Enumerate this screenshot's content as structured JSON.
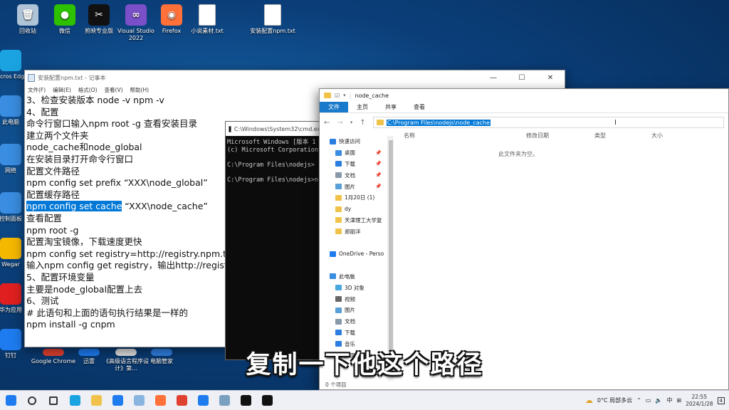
{
  "desktop": {
    "icons": [
      {
        "label": "回收站",
        "color": "#b0c4d8",
        "glyph": "🗑",
        "name": "recycle-bin-icon"
      },
      {
        "label": "微信",
        "color": "#2dc100",
        "glyph": "●",
        "name": "wechat-icon"
      },
      {
        "label": "剪映专业版",
        "color": "#111111",
        "glyph": "✂",
        "name": "jianying-icon"
      },
      {
        "label": "Visual Studio 2022",
        "color": "#7a4fc7",
        "glyph": "∞",
        "name": "visual-studio-icon"
      },
      {
        "label": "Firefox",
        "color": "#ff7139",
        "glyph": "◉",
        "name": "firefox-icon"
      },
      {
        "label": "小说素材.txt",
        "color": "#ffffff",
        "glyph": "",
        "name": "txt-file-icon"
      },
      {
        "label": "安装配置npm.txt",
        "color": "#ffffff",
        "glyph": "",
        "name": "txt-file-icon"
      }
    ],
    "left_icons": [
      {
        "label": "Micros Edge",
        "color": "#1aa3e0",
        "name": "edge-icon"
      },
      {
        "label": "此电脑",
        "color": "#3a8de0",
        "name": "this-pc-icon"
      },
      {
        "label": "网络",
        "color": "#3a8de0",
        "name": "network-icon"
      },
      {
        "label": "控制面板",
        "color": "#3a8de0",
        "name": "control-panel-icon"
      },
      {
        "label": "Wegar",
        "color": "#f5b800",
        "name": "app-icon"
      },
      {
        "label": "华为应用",
        "color": "#e02020",
        "name": "huawei-icon"
      },
      {
        "label": "钉钉",
        "color": "#1e7cf0",
        "name": "dingtalk-icon"
      }
    ],
    "bottom_icons": [
      {
        "label": "Google Chrome",
        "color": "#e04030",
        "name": "chrome-icon"
      },
      {
        "label": "迅雷",
        "color": "#1e7cf0",
        "name": "xunlei-icon"
      },
      {
        "label": "《高级语言程序设计》第...",
        "color": "#dddddd",
        "name": "doc-icon"
      },
      {
        "label": "电脑管家",
        "color": "#2f7fe0",
        "name": "pc-manager-icon"
      }
    ]
  },
  "notepad": {
    "title": "安装配置npm.txt - 记事本",
    "menu": [
      "文件(F)",
      "编辑(E)",
      "格式(O)",
      "查看(V)",
      "帮助(H)"
    ],
    "lines": [
      {
        "pre": "3、检查安装版本 node -v npm -v",
        "sel": "",
        "post": ""
      },
      {
        "pre": "4、配置",
        "sel": "",
        "post": ""
      },
      {
        "pre": "命令行窗口输入npm root -g 查看安装目录",
        "sel": "",
        "post": ""
      },
      {
        "pre": "建立两个文件夹",
        "sel": "",
        "post": ""
      },
      {
        "pre": "node_cache和node_global",
        "sel": "",
        "post": ""
      },
      {
        "pre": "在安装目录打开命令行窗口",
        "sel": "",
        "post": ""
      },
      {
        "pre": "配置文件路径",
        "sel": "",
        "post": ""
      },
      {
        "pre": "npm config set prefix “XXX\\node_global”",
        "sel": "",
        "post": ""
      },
      {
        "pre": "配置缓存路径",
        "sel": "",
        "post": ""
      },
      {
        "pre": "",
        "sel": "npm config set cache",
        "post": " “XXX\\node_cache”"
      },
      {
        "pre": "查看配置",
        "sel": "",
        "post": ""
      },
      {
        "pre": "npm root -g",
        "sel": "",
        "post": ""
      },
      {
        "pre": "配置淘宝镜像，下载速度更快",
        "sel": "",
        "post": ""
      },
      {
        "pre": "npm config set registry=http://registry.npm.ta",
        "sel": "",
        "post": ""
      },
      {
        "pre": "输入npm config get registry，输出http://regist",
        "sel": "",
        "post": ""
      },
      {
        "pre": "5、配置环境变量",
        "sel": "",
        "post": ""
      },
      {
        "pre": "主要是node_global配置上去",
        "sel": "",
        "post": ""
      },
      {
        "pre": "6、测试",
        "sel": "",
        "post": ""
      },
      {
        "pre": "# 此语句和上面的语句执行结果是一样的",
        "sel": "",
        "post": ""
      },
      {
        "pre": "npm install -g cnpm",
        "sel": "",
        "post": ""
      }
    ]
  },
  "cmd": {
    "title": "C:\\Windows\\System32\\cmd.exe",
    "lines": [
      "Microsoft Windows [版本 1",
      "(c) Microsoft Corporation",
      "",
      "C:\\Program Files\\nodejs>",
      "",
      "C:\\Program Files\\nodejs>n"
    ]
  },
  "explorer": {
    "title": "node_cache",
    "tabs": [
      "文件",
      "主页",
      "共享",
      "查看"
    ],
    "address": "C:\\Program Files\\nodejs\\node_cache",
    "columns": [
      "名称",
      "修改日期",
      "类型",
      "大小"
    ],
    "empty_text": "此文件夹为空。",
    "status": "0 个项目",
    "nav": [
      {
        "label": "快速访问",
        "color": "#2b7de0",
        "indent": 0,
        "pin": false
      },
      {
        "label": "桌面",
        "color": "#3a8de0",
        "indent": 1,
        "pin": true
      },
      {
        "label": "下载",
        "color": "#2b7de0",
        "indent": 1,
        "pin": true
      },
      {
        "label": "文档",
        "color": "#8899aa",
        "indent": 1,
        "pin": true
      },
      {
        "label": "图片",
        "color": "#5aa0d8",
        "indent": 1,
        "pin": true
      },
      {
        "label": "1月20日 (1)",
        "color": "#f0c24a",
        "indent": 1,
        "pin": false
      },
      {
        "label": "dy",
        "color": "#f0c24a",
        "indent": 1,
        "pin": false
      },
      {
        "label": "天津理工大学复",
        "color": "#f0c24a",
        "indent": 1,
        "pin": false
      },
      {
        "label": "郑丽洋",
        "color": "#f0c24a",
        "indent": 1,
        "pin": false
      },
      {
        "label": "",
        "color": "",
        "indent": 0,
        "pin": false
      },
      {
        "label": "OneDrive - Perso",
        "color": "#1e7cf0",
        "indent": 0,
        "pin": false
      },
      {
        "label": "",
        "color": "",
        "indent": 0,
        "pin": false
      },
      {
        "label": "此电脑",
        "color": "#3a8de0",
        "indent": 0,
        "pin": false
      },
      {
        "label": "3D 对象",
        "color": "#4aa8e0",
        "indent": 1,
        "pin": false
      },
      {
        "label": "视频",
        "color": "#666666",
        "indent": 1,
        "pin": false
      },
      {
        "label": "图片",
        "color": "#5aa0d8",
        "indent": 1,
        "pin": false
      },
      {
        "label": "文档",
        "color": "#8899aa",
        "indent": 1,
        "pin": false
      },
      {
        "label": "下载",
        "color": "#2b7de0",
        "indent": 1,
        "pin": false
      },
      {
        "label": "音乐",
        "color": "#2b7de0",
        "indent": 1,
        "pin": false
      },
      {
        "label": "桌面",
        "color": "#3a8de0",
        "indent": 1,
        "pin": false
      }
    ]
  },
  "subtitle": "复制一下他这个路径",
  "taskbar": {
    "apps": [
      {
        "name": "start-button",
        "color": "#1e7cf0"
      },
      {
        "name": "search-icon",
        "color": "#333333"
      },
      {
        "name": "task-view-icon",
        "color": "#333333"
      },
      {
        "name": "edge-icon",
        "color": "#1aa3e0"
      },
      {
        "name": "file-explorer-icon",
        "color": "#f0c24a"
      },
      {
        "name": "mail-icon",
        "color": "#1e7cf0"
      },
      {
        "name": "notepad-icon",
        "color": "#8ab4e0"
      },
      {
        "name": "firefox-icon",
        "color": "#ff7139"
      },
      {
        "name": "chrome-icon",
        "color": "#e04030"
      },
      {
        "name": "dingtalk-icon",
        "color": "#1e7cf0"
      },
      {
        "name": "app-icon",
        "color": "#7aa0c0"
      },
      {
        "name": "capcut-icon",
        "color": "#111111"
      },
      {
        "name": "cmd-icon",
        "color": "#111111"
      }
    ],
    "weather": "0°C 局部多云",
    "ime": "中",
    "time": "22:55",
    "date": "2024/1/28",
    "notifications": "4"
  }
}
